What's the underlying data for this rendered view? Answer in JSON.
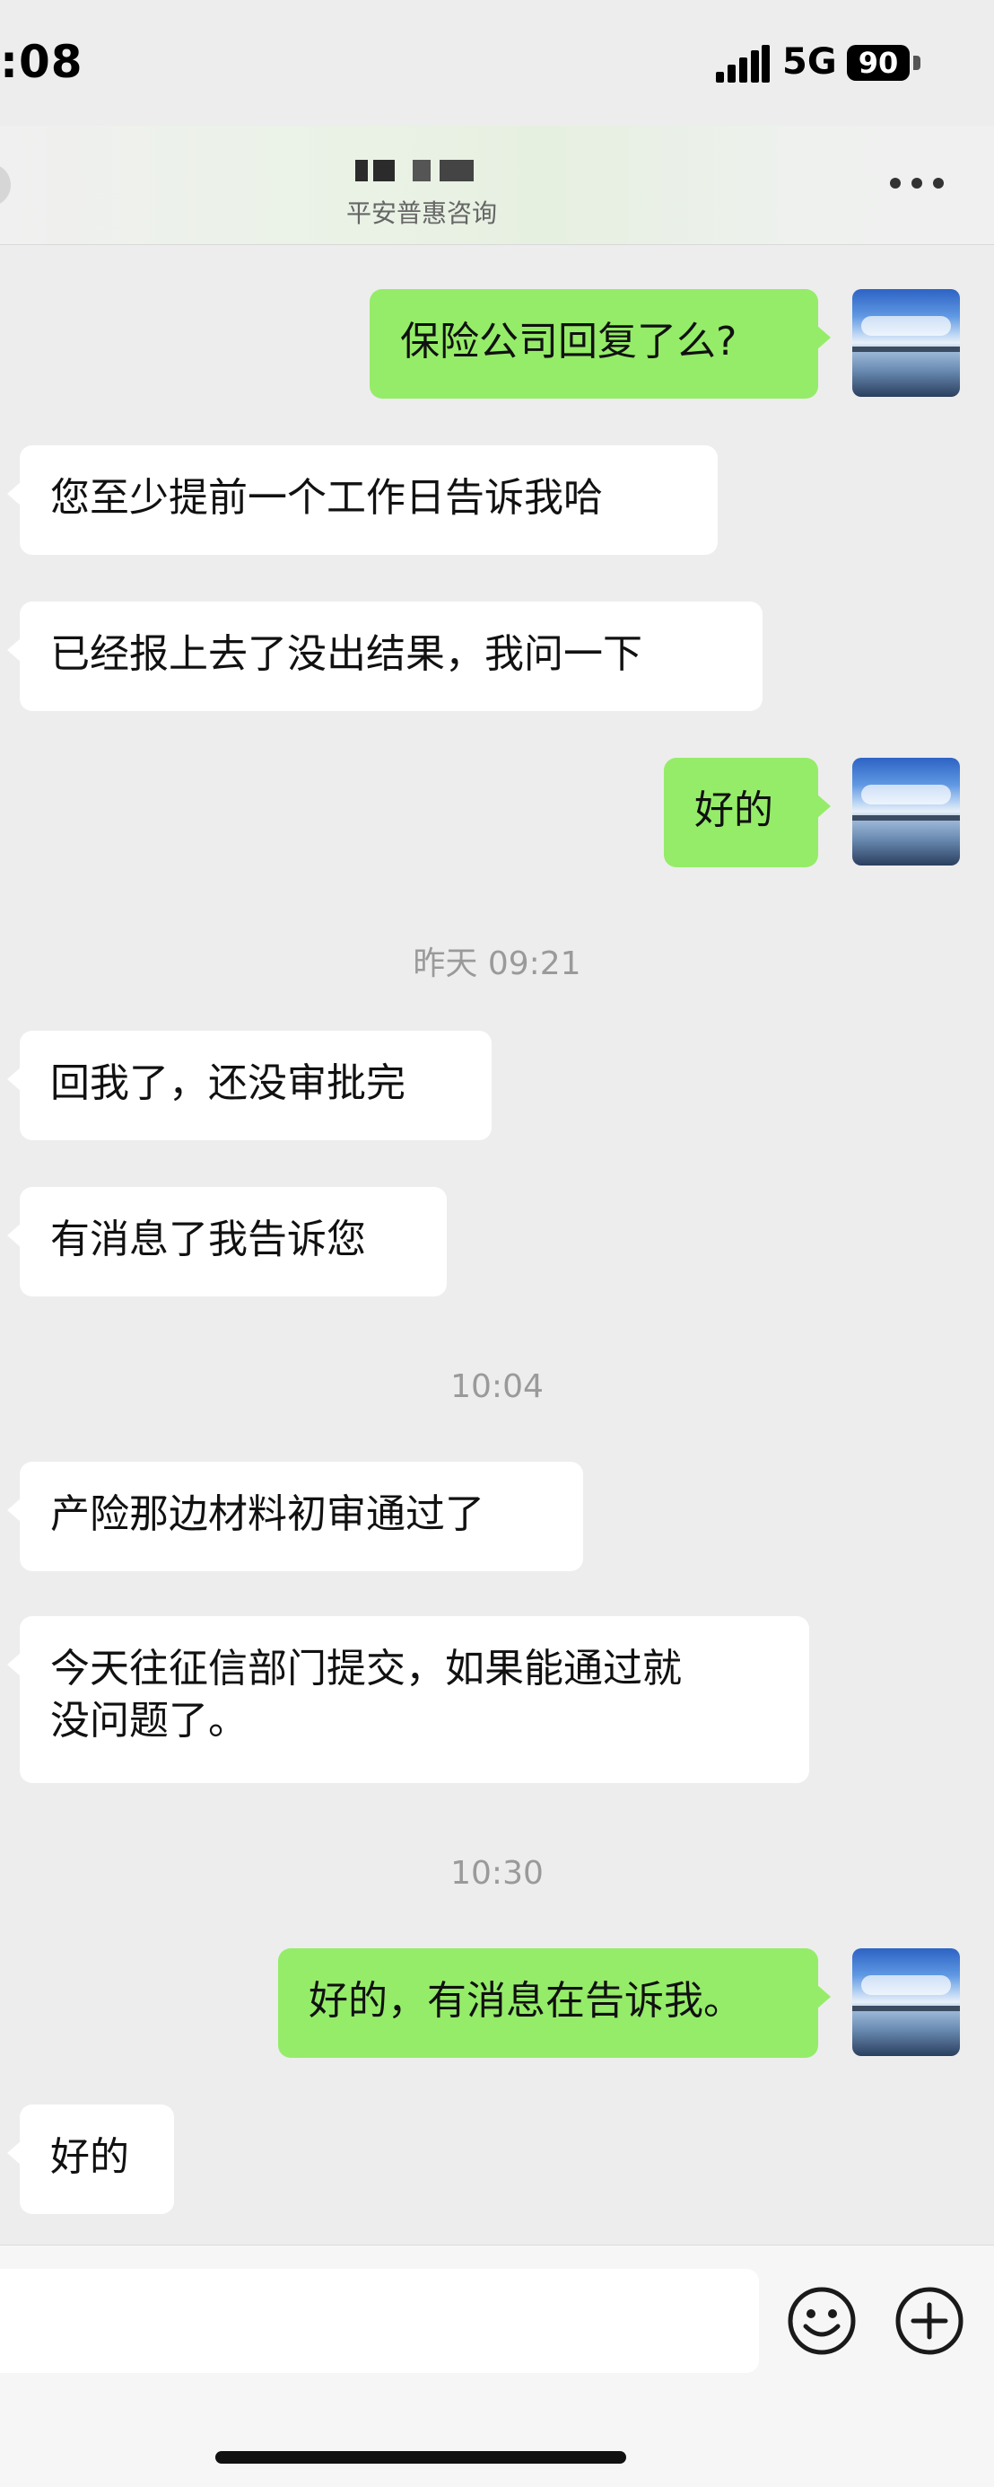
{
  "status_bar": {
    "time": ":08",
    "network": "5G",
    "battery": "90"
  },
  "nav": {
    "subtitle": "平安普惠咨询"
  },
  "messages": [
    {
      "side": "out",
      "text": "保险公司回复了么?"
    },
    {
      "side": "in",
      "text": "您至少提前一个工作日告诉我哈"
    },
    {
      "side": "in",
      "text": "已经报上去了没出结果，我问一下"
    },
    {
      "side": "out",
      "text": "好的"
    },
    {
      "type": "timestamp",
      "text": "昨天 09:21"
    },
    {
      "side": "in",
      "text": "回我了，还没审批完"
    },
    {
      "side": "in",
      "text": "有消息了我告诉您"
    },
    {
      "type": "timestamp",
      "text": "10:04"
    },
    {
      "side": "in",
      "text": "产险那边材料初审通过了"
    },
    {
      "side": "in",
      "lines": [
        "今天往征信部门提交，如果能通过就",
        "没问题了。"
      ]
    },
    {
      "type": "timestamp",
      "text": "10:30"
    },
    {
      "side": "out",
      "text": "好的，有消息在告诉我。"
    },
    {
      "side": "in",
      "text": "好的"
    }
  ],
  "input_bar": {
    "emoji_icon": "smiley-icon",
    "plus_icon": "plus-circle-icon"
  }
}
